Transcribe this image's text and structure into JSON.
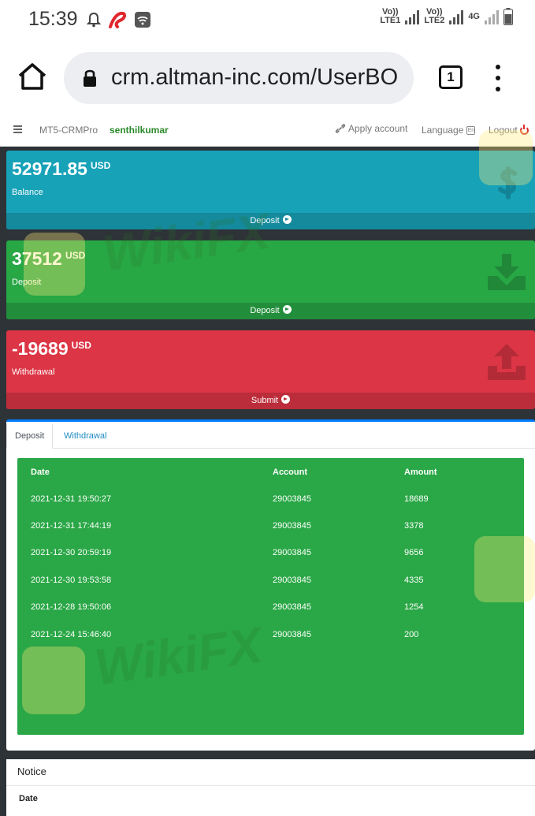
{
  "status_bar": {
    "time": "15:39",
    "sim1_label": "Vo)) LTE1",
    "sim2_label": "Vo)) LTE2",
    "network": "4G"
  },
  "browser": {
    "url": "crm.altman-inc.com/UserBO",
    "tab_count": "1"
  },
  "navbar": {
    "brand": "MT5-CRMPro",
    "username": "senthilkumar",
    "apply_account": "Apply account",
    "language": "Language",
    "logout": "Logout"
  },
  "cards": {
    "balance": {
      "amount": "52971.85",
      "currency": "USD",
      "label": "Balance",
      "footer": "Deposit",
      "color": "#17a2b8"
    },
    "deposit": {
      "amount": "37512",
      "currency": "USD",
      "label": "Deposit",
      "footer": "Deposit",
      "color": "#28a745"
    },
    "withdrawal": {
      "amount": "-19689",
      "currency": "USD",
      "label": "Withdrawal",
      "footer": "Submit",
      "color": "#dc3545"
    }
  },
  "tabs": {
    "deposit": "Deposit",
    "withdrawal": "Withdrawal"
  },
  "table": {
    "headers": {
      "date": "Date",
      "account": "Account",
      "amount": "Amount"
    },
    "rows": [
      {
        "date": "2021-12-31 19:50:27",
        "account": "29003845",
        "amount": "18689"
      },
      {
        "date": "2021-12-31 17:44:19",
        "account": "29003845",
        "amount": "3378"
      },
      {
        "date": "2021-12-30 20:59:19",
        "account": "29003845",
        "amount": "9656"
      },
      {
        "date": "2021-12-30 19:53:58",
        "account": "29003845",
        "amount": "4335"
      },
      {
        "date": "2021-12-28 19:50:06",
        "account": "29003845",
        "amount": "1254"
      },
      {
        "date": "2021-12-24 15:46:40",
        "account": "29003845",
        "amount": "200"
      }
    ]
  },
  "notice": {
    "title": "Notice",
    "date_header": "Date"
  },
  "watermark": "WikiFX"
}
